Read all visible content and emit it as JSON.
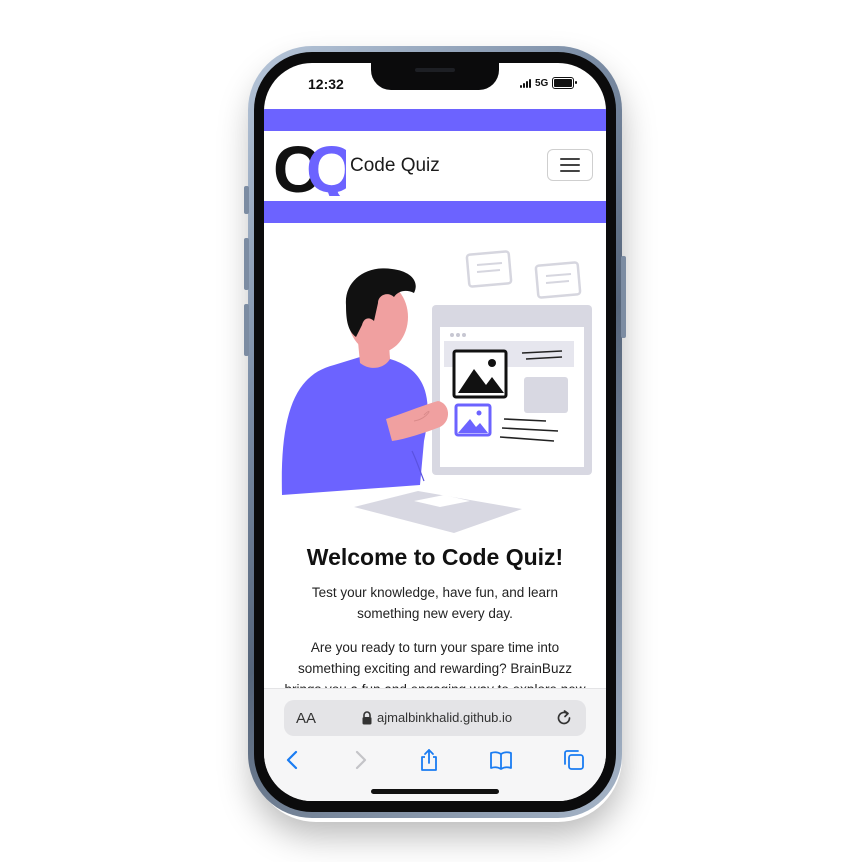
{
  "status_bar": {
    "time": "12:32",
    "network": "5G"
  },
  "navbar": {
    "logo_text": "CQ",
    "brand": "Code Quiz",
    "toggler_icon": "hamburger-menu-icon"
  },
  "hero": {
    "title": "Welcome to Code Quiz!",
    "subtitle": "Test your knowledge, have fun, and learn something new every day.",
    "body": "Are you ready to turn your spare time into something exciting and rewarding? BrainBuzz brings you a fun and engaging way to explore new"
  },
  "browser": {
    "text_size_label": "AA",
    "url": "ajmalbinkhalid.github.io",
    "toolbar_icons": [
      "back-icon",
      "forward-icon",
      "share-icon",
      "bookmarks-icon",
      "tabs-icon"
    ]
  },
  "colors": {
    "accent": "#6c63ff",
    "skin": "#f0a0a0",
    "hair": "#111111",
    "toolbar_blue": "#1a7cf2"
  }
}
